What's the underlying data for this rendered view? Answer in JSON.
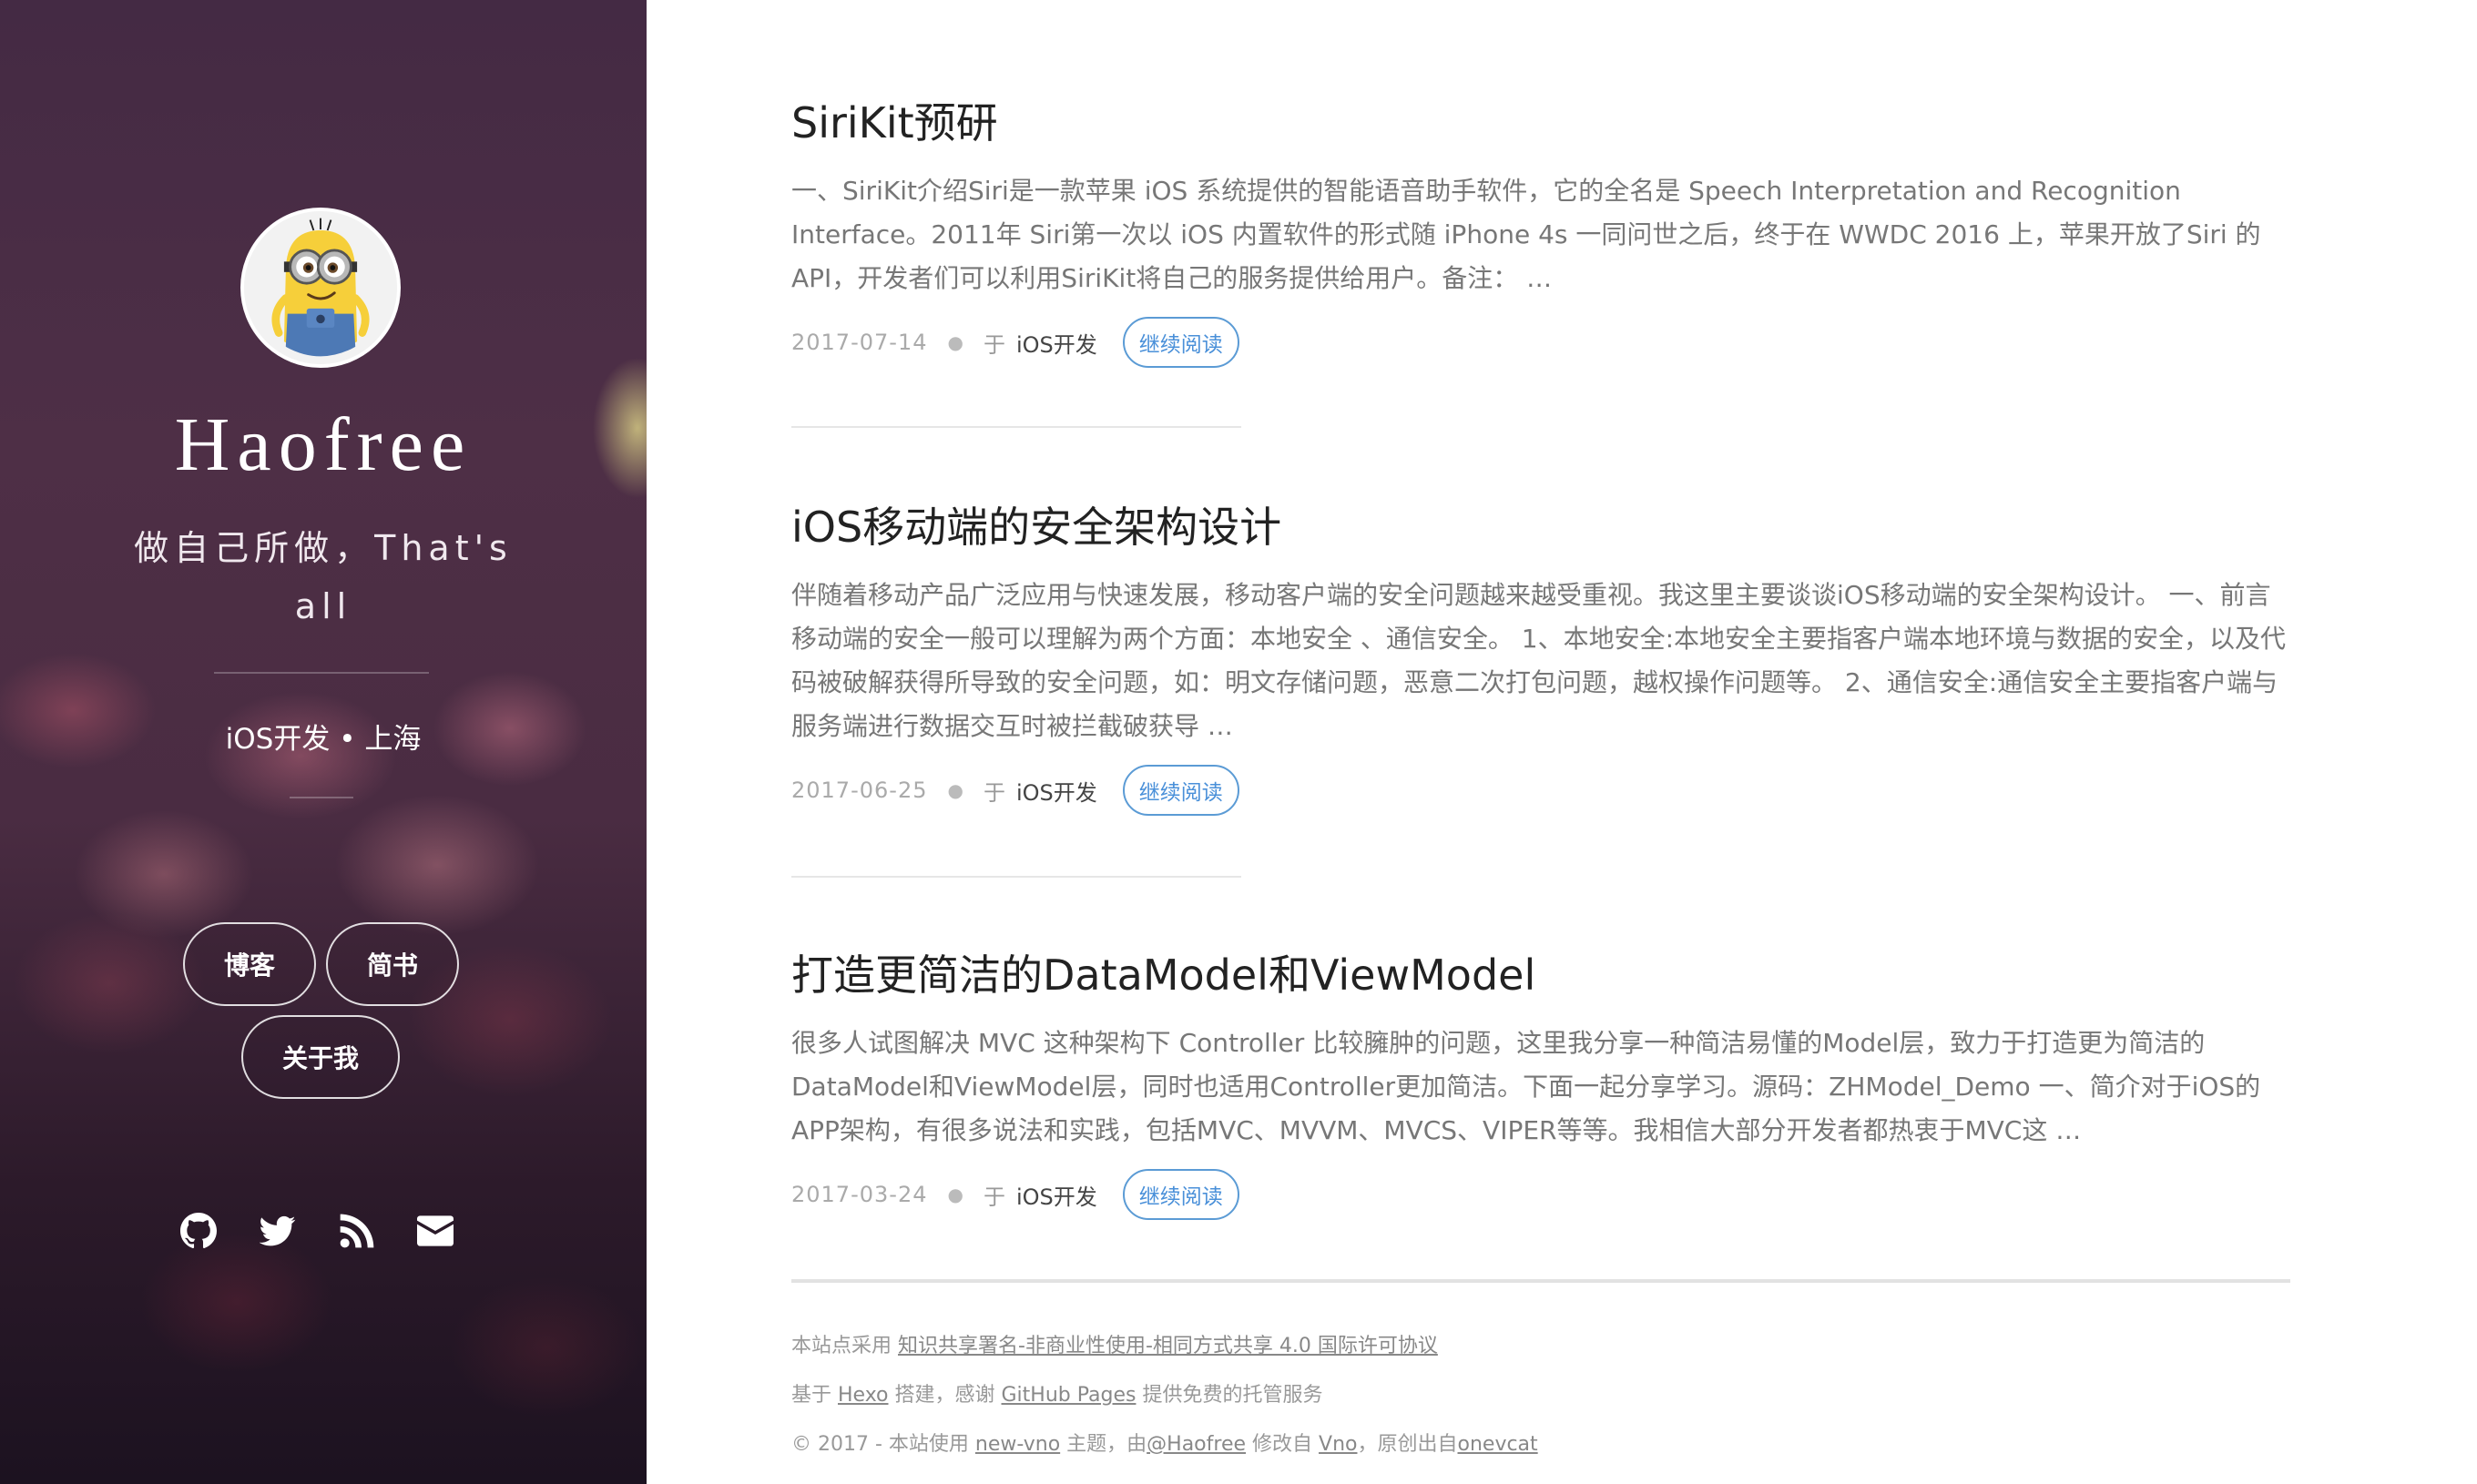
{
  "sidebar": {
    "title": "Haofree",
    "description": "做自己所做，That's all",
    "meta": "iOS开发 • 上海",
    "nav": {
      "blog": "博客",
      "jianshu": "简书",
      "about": "关于我"
    },
    "social_icons": [
      "github-icon",
      "twitter-icon",
      "rss-icon",
      "mail-icon"
    ]
  },
  "posts": [
    {
      "title": "SiriKit预研",
      "excerpt": "一、SiriKit介绍Siri是一款苹果 iOS 系统提供的智能语音助手软件，它的全名是 Speech Interpretation and Recognition Interface。2011年 Siri第一次以 iOS 内置软件的形式随 iPhone 4s 一同问世之后，终于在 WWDC 2016 上，苹果开放了Siri 的 API，开发者们可以利用SiriKit将自己的服务提供给用户。备注： …",
      "date": "2017-07-14",
      "yu": "于",
      "category": "iOS开发",
      "read_more": "继续阅读"
    },
    {
      "title": "iOS移动端的安全架构设计",
      "excerpt": "伴随着移动产品广泛应用与快速发展，移动客户端的安全问题越来越受重视。我这里主要谈谈iOS移动端的安全架构设计。 一、前言 移动端的安全一般可以理解为两个方面：本地安全 、通信安全。 1、本地安全:本地安全主要指客户端本地环境与数据的安全，以及代码被破解获得所导致的安全问题，如：明文存储问题，恶意二次打包问题，越权操作问题等。 2、通信安全:通信安全主要指客户端与服务端进行数据交互时被拦截破获导 …",
      "date": "2017-06-25",
      "yu": "于",
      "category": "iOS开发",
      "read_more": "继续阅读"
    },
    {
      "title": "打造更简洁的DataModel和ViewModel",
      "excerpt": "很多人试图解决 MVC 这种架构下 Controller 比较臃肿的问题，这里我分享一种简洁易懂的Model层，致力于打造更为简洁的DataModel和ViewModel层，同时也适用Controller更加简洁。下面一起分享学习。源码：ZHModel_Demo 一、简介对于iOS的APP架构，有很多说法和实践，包括MVC、MVVM、MVCS、VIPER等等。我相信大部分开发者都热衷于MVC这 …",
      "date": "2017-03-24",
      "yu": "于",
      "category": "iOS开发",
      "read_more": "继续阅读"
    }
  ],
  "footer": {
    "license_prefix": "本站点采用 ",
    "license_link": "知识共享署名-非商业性使用-相同方式共享 4.0 国际许可协议",
    "built_prefix": "基于 ",
    "hexo": "Hexo",
    "built_mid": " 搭建，感谢 ",
    "github_pages": "GitHub Pages",
    "built_suffix": " 提供免费的托管服务",
    "copy_prefix": "© 2017 - 本站使用 ",
    "theme": "new-vno",
    "copy_mid1": " 主题，由",
    "author": "@Haofree",
    "copy_mid2": " 修改自 ",
    "vno": "Vno",
    "copy_mid3": "，原创出自",
    "onevcat": "onevcat"
  }
}
